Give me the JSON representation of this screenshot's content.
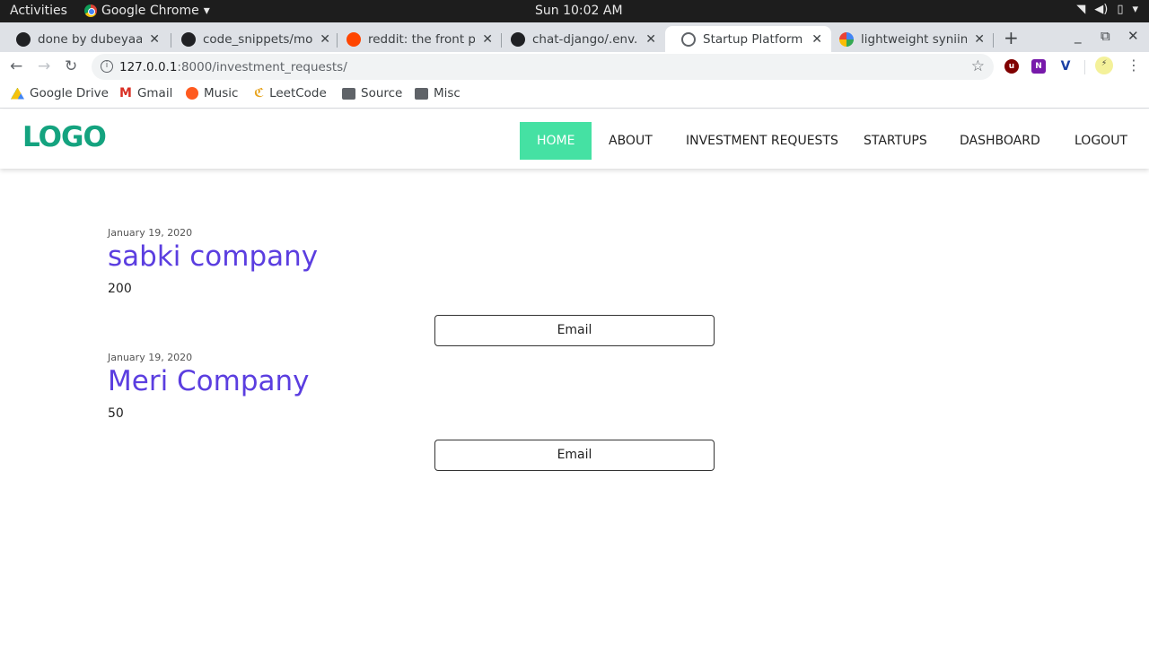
{
  "system": {
    "activities": "Activities",
    "app_name": "Google Chrome",
    "clock": "Sun 10:02 AM"
  },
  "tabs": [
    {
      "title": "done by dubeyaayu",
      "icon": "github-icon"
    },
    {
      "title": "code_snippets/mo",
      "icon": "github-icon"
    },
    {
      "title": "reddit: the front pa",
      "icon": "reddit-icon"
    },
    {
      "title": "chat-django/.env.e",
      "icon": "github-icon"
    },
    {
      "title": "Startup Platform",
      "icon": "globe-icon",
      "active": true
    },
    {
      "title": "lightweight syniiny",
      "icon": "google-icon"
    }
  ],
  "toolbar": {
    "url_host": "127.0.0.1",
    "url_path": ":8000/investment_requests/"
  },
  "bookmarks": [
    {
      "label": "Google Drive",
      "icon": "google-drive-icon"
    },
    {
      "label": "Gmail",
      "icon": "gmail-icon"
    },
    {
      "label": "Music",
      "icon": "music-icon"
    },
    {
      "label": "LeetCode",
      "icon": "leetcode-icon"
    },
    {
      "label": "Source",
      "icon": "folder-icon"
    },
    {
      "label": "Misc",
      "icon": "folder-icon"
    }
  ],
  "site": {
    "logo": "LOGO",
    "nav": [
      {
        "label": "HOME",
        "active": true
      },
      {
        "label": "ABOUT"
      },
      {
        "label": "INVESTMENT REQUESTS"
      },
      {
        "label": "STARTUPS"
      },
      {
        "label": "DASHBOARD"
      },
      {
        "label": "LOGOUT"
      }
    ],
    "colors": {
      "logo": "#14a37f",
      "nav_active": "#45e1a3",
      "company": "#5b3ee0"
    }
  },
  "requests": [
    {
      "date": "January 19, 2020",
      "company": "sabki company",
      "amount": "200",
      "action": "Email"
    },
    {
      "date": "January 19, 2020",
      "company": "Meri Company",
      "amount": "50",
      "action": "Email"
    }
  ]
}
